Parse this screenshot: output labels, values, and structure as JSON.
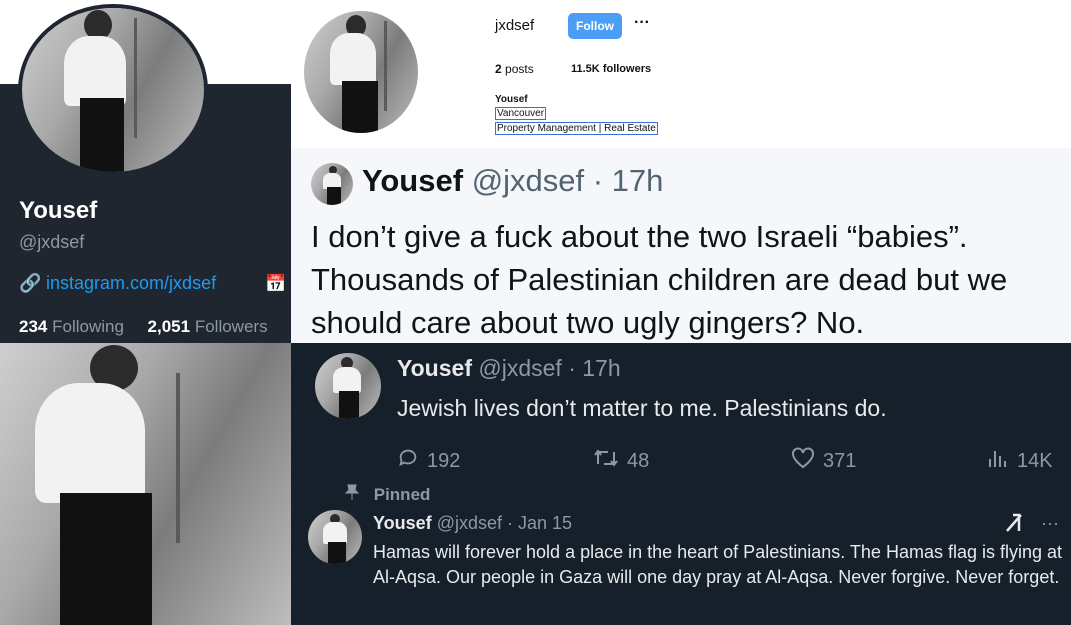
{
  "twitter_profile": {
    "name": "Yousef",
    "handle": "@jxdsef",
    "link": "instagram.com/jxdsef",
    "link_icon": "link-icon",
    "calendar_icon": "calendar-icon",
    "following_count": "234",
    "following_label": "Following",
    "followers_count": "2,051",
    "followers_label": "Followers"
  },
  "instagram_profile": {
    "username": "jxdsef",
    "follow_label": "Follow",
    "more_label": "···",
    "posts_count": "2",
    "posts_label": "posts",
    "followers_count": "11.5K",
    "followers_label": "followers",
    "bio_name": "Yousef",
    "bio_city": "Vancouver",
    "bio_work": "Property Management | Real Estate"
  },
  "tweet_main": {
    "name": "Yousef",
    "handle_time": "@jxdsef · 17h",
    "text": "I don’t give a fuck about the two Israeli “babies”. Thousands of Palestinian children are dead but we should care about two ugly gingers? No."
  },
  "tweet_reply": {
    "name": "Yousef",
    "handle_time": "@jxdsef · 17h",
    "text": "Jewish lives don’t matter to me. Palestinians do.",
    "replies": "192",
    "retweets": "48",
    "likes": "371",
    "views": "14K"
  },
  "tweet_pinned": {
    "pinned_label": "Pinned",
    "name": "Yousef",
    "handle_time": "@jxdsef · Jan 15",
    "text": "Hamas will forever hold a place in the heart of Palestinians. The Hamas flag is flying at Al-Aqsa. Our people in Gaza will one day pray at Al-Aqsa. Never forgive. Never forget.",
    "more_label": "···"
  },
  "colors": {
    "twitter_dark_bg": "#15202b",
    "twitter_profile_bg": "#1f2630",
    "twitter_blue": "#1d9bf0",
    "instagram_follow_blue": "#4a9ef5",
    "muted_text": "#8b98a5"
  }
}
